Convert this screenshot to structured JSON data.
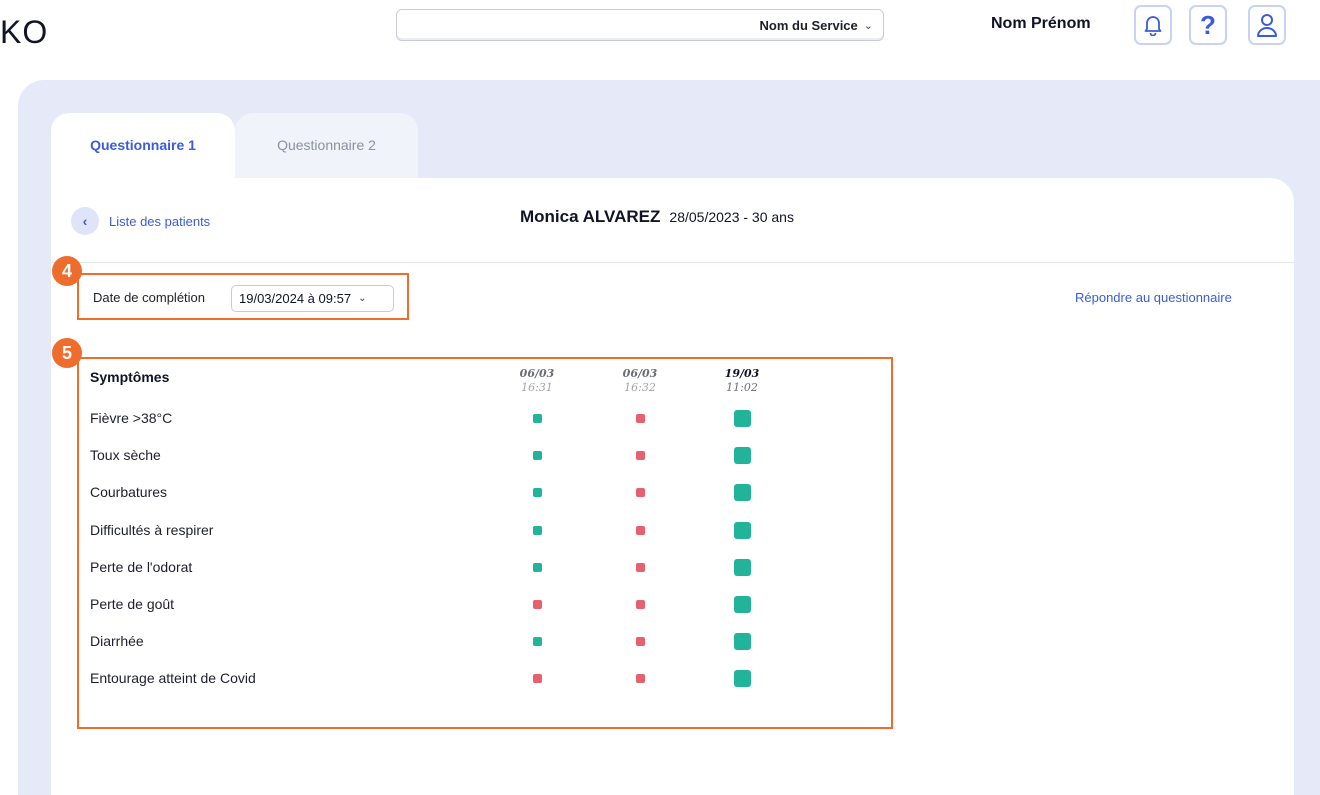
{
  "app": {
    "logo": "KO"
  },
  "header": {
    "service": "Nom du Service",
    "user_name": "Nom Prénom",
    "icons": [
      "bell-icon",
      "help-icon",
      "user-icon"
    ]
  },
  "tabs": [
    {
      "label": "Questionnaire 1",
      "active": true
    },
    {
      "label": "Questionnaire 2",
      "active": false
    }
  ],
  "nav": {
    "back_label": "Liste des patients"
  },
  "patient": {
    "name": "Monica ALVAREZ",
    "info": "28/05/2023 - 30 ans"
  },
  "markers": [
    "4",
    "5"
  ],
  "completion": {
    "label": "Date de complétion",
    "value": "19/03/2024 à 09:57"
  },
  "answer_link": "Répondre au questionnaire",
  "symptoms": {
    "title": "Symptômes",
    "columns": [
      {
        "date": "06/03",
        "time": "16:31"
      },
      {
        "date": "06/03",
        "time": "16:32"
      },
      {
        "date": "19/03",
        "time": "11:02"
      }
    ],
    "rows": [
      {
        "label": "Fièvre >38°C",
        "values": [
          "green",
          "red",
          "green"
        ]
      },
      {
        "label": "Toux sèche",
        "values": [
          "green",
          "red",
          "green"
        ]
      },
      {
        "label": "Courbatures",
        "values": [
          "green",
          "red",
          "green"
        ]
      },
      {
        "label": "Difficultés à respirer",
        "values": [
          "green",
          "red",
          "green"
        ]
      },
      {
        "label": "Perte de l'odorat",
        "values": [
          "green",
          "red",
          "green"
        ]
      },
      {
        "label": "Perte de goût",
        "values": [
          "red",
          "red",
          "green"
        ]
      },
      {
        "label": "Diarrhée",
        "values": [
          "green",
          "red",
          "green"
        ]
      },
      {
        "label": "Entourage atteint de Covid",
        "values": [
          "red",
          "red",
          "green"
        ]
      }
    ]
  },
  "colors": {
    "accent": "#3a5be0",
    "highlight": "#ee6c2c",
    "green": "#22b39b",
    "red": "#e5616e"
  }
}
